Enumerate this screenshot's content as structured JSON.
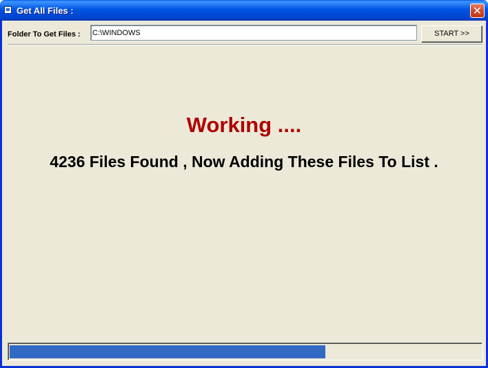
{
  "window": {
    "title": "Get All Files :",
    "close_glyph": "✕",
    "icon": "app-icon"
  },
  "folder": {
    "label": "Folder To Get Files :",
    "value": "C:\\WINDOWS"
  },
  "start_button": {
    "label": "START >>"
  },
  "status": {
    "working": "Working ....",
    "message": "4236  Files Found , Now Adding These Files To List ."
  },
  "progress": {
    "fraction": 0.67
  },
  "colors": {
    "working_text": "#B00000",
    "progress_fill": "#316AC5",
    "window_bg": "#ECE9D8",
    "titlebar": "#0054E3"
  }
}
